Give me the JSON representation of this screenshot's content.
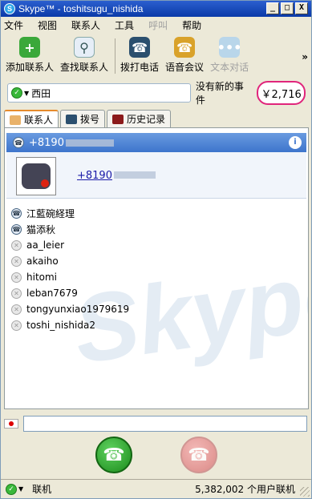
{
  "window": {
    "title": "Skype™ - toshitsugu_nishida",
    "buttons": {
      "minimize": "_",
      "maximize": "□",
      "close": "X"
    }
  },
  "menu": {
    "items": [
      "文件",
      "视图",
      "联系人",
      "工具",
      "呼叫",
      "帮助"
    ]
  },
  "toolbar": {
    "add_contact": "添加联系人",
    "find_contact": "查找联系人",
    "call_phone": "拨打电话",
    "conference": "语音会议",
    "text_chat": "文本对话",
    "more": "»"
  },
  "status": {
    "name": "西田",
    "events": "没有新的事件",
    "credit": "￥2,716"
  },
  "tabs": [
    {
      "label": "联系人"
    },
    {
      "label": "拨号"
    },
    {
      "label": "历史记录"
    }
  ],
  "selected_contact": {
    "number_prefix": "+8190",
    "link_prefix": "+8190",
    "info_icon": "i"
  },
  "contacts": [
    {
      "name": "江藍碗経理",
      "status": "online"
    },
    {
      "name": "猫添秋",
      "status": "online"
    },
    {
      "name": "aa_leier",
      "status": "offline"
    },
    {
      "name": "akaiho",
      "status": "offline"
    },
    {
      "name": "hitomi",
      "status": "offline"
    },
    {
      "name": "leban7679",
      "status": "offline"
    },
    {
      "name": "tongyunxiao1979619",
      "status": "offline"
    },
    {
      "name": "toshi_nishida2",
      "status": "offline"
    }
  ],
  "dial": {
    "value": ""
  },
  "statusbar": {
    "status": "联机",
    "users": "5,382,002 个用户联机"
  },
  "colors": {
    "accent": "#3d75cc",
    "credit_highlight": "#e0257b",
    "call_green": "#1b8a1b"
  }
}
